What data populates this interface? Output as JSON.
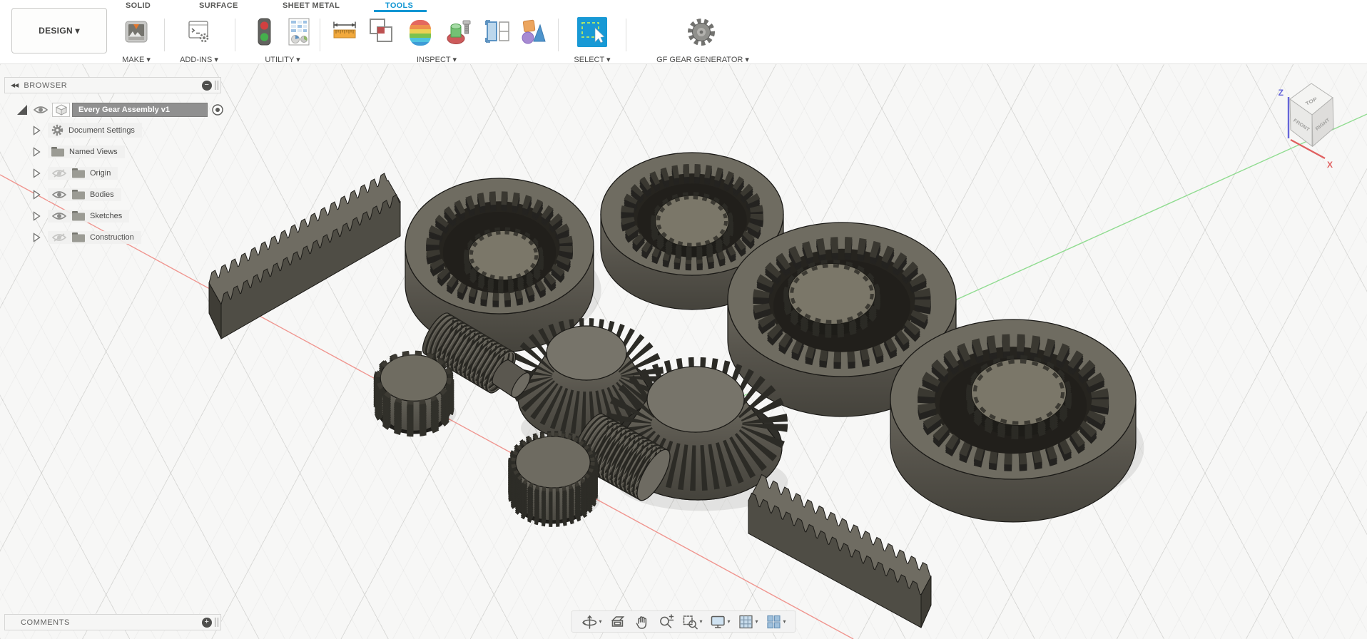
{
  "tabs": {
    "solid": "SOLID",
    "surface": "SURFACE",
    "sheet_metal": "SHEET METAL",
    "tools": "TOOLS"
  },
  "toolbar": {
    "design_label": "DESIGN ▾",
    "make_label": "MAKE ▾",
    "addins_label": "ADD-INS ▾",
    "utility_label": "UTILITY ▾",
    "inspect_label": "INSPECT ▾",
    "select_label": "SELECT ▾",
    "gear_generator_label": "GF GEAR GENERATOR ▾"
  },
  "browser": {
    "title": "BROWSER",
    "root_label": "Every Gear Assembly v1",
    "items": [
      {
        "label": "Document Settings",
        "icon": "gear-icon",
        "visibility": "none"
      },
      {
        "label": "Named Views",
        "icon": "folder-icon",
        "visibility": "none"
      },
      {
        "label": "Origin",
        "icon": "folder-icon",
        "visibility": "hidden"
      },
      {
        "label": "Bodies",
        "icon": "folder-icon",
        "visibility": "visible"
      },
      {
        "label": "Sketches",
        "icon": "folder-icon",
        "visibility": "visible"
      },
      {
        "label": "Construction",
        "icon": "folder-icon",
        "visibility": "hidden"
      }
    ]
  },
  "comments": {
    "title": "COMMENTS"
  },
  "viewcube": {
    "top": "TOP",
    "front": "FRONT",
    "right": "RIGHT",
    "z": "Z",
    "x": "X"
  },
  "viewport": {
    "objects": [
      "gear-rack-left",
      "ring-gear-helical-1",
      "ring-gear-spur-1",
      "ring-gear-spur-2",
      "ring-gear-helical-2",
      "bevel-gear-small",
      "worm-gear-1",
      "spur-gear-small",
      "bevel-gear-large",
      "worm-gear-2",
      "knurled-cylinder-gear",
      "gear-rack-right"
    ]
  },
  "colors": {
    "accent_blue": "#1296d3",
    "select_blue": "#1899d5",
    "axis_red": "#f0958f",
    "axis_green": "#90dc90",
    "gear_top": "#6f6c61",
    "gear_side": "#55524a",
    "gear_teeth": "#31302a",
    "viewport_bg": "#f7f7f6"
  }
}
